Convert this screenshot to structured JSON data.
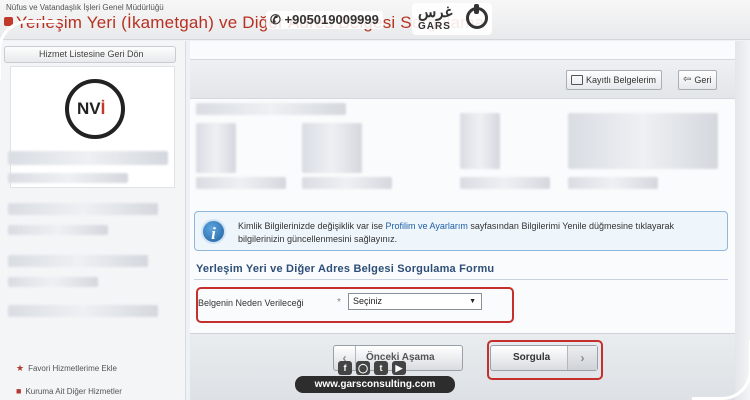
{
  "header": {
    "ministry": "Nüfus ve Vatandaşlık İşleri Genel Müdürlüğü",
    "service_title": "Yerleşim Yeri (İkametgah) ve Diğer Adres Belgesi Sorgulama"
  },
  "overlay": {
    "phone": "+905019009999",
    "brand_arabic": "غرس",
    "brand_latin": "GARS",
    "website": "www.garsconsulting.com",
    "social_icons": [
      "facebook-icon",
      "instagram-icon",
      "twitter-icon",
      "youtube-icon"
    ]
  },
  "sidebar": {
    "back_label": "Hizmet Listesine Geri Dön",
    "logo_text_nv": "NV",
    "logo_text_i": "İ",
    "favorites_label": "Favori Hizmetlerime Ekle",
    "related_label": "Kuruma Ait Diğer Hizmetler"
  },
  "toolbar": {
    "saved_label": "Kayıtlı Belgelerim",
    "back_label": "Geri"
  },
  "info": {
    "text_before": "Kimlik Bilgilerinizde değişiklik var ise ",
    "link": "Profilim ve Ayarlarım",
    "text_after": " sayfasından Bilgilerimi Yenile düğmesine tıklayarak bilgilerinizin güncellenmesini sağlayınız."
  },
  "form": {
    "title": "Yerleşim Yeri ve Diğer Adres Belgesi Sorgulama Formu",
    "field_label": "Belgenin Neden Verileceği",
    "required_mark": "*",
    "select_value": "Seçiniz"
  },
  "actions": {
    "prev_label": "Önceki Aşama",
    "query_label": "Sorgula"
  },
  "colors": {
    "highlight": "#c4302b",
    "link": "#1d5fa6",
    "form_title": "#2d4e78"
  }
}
